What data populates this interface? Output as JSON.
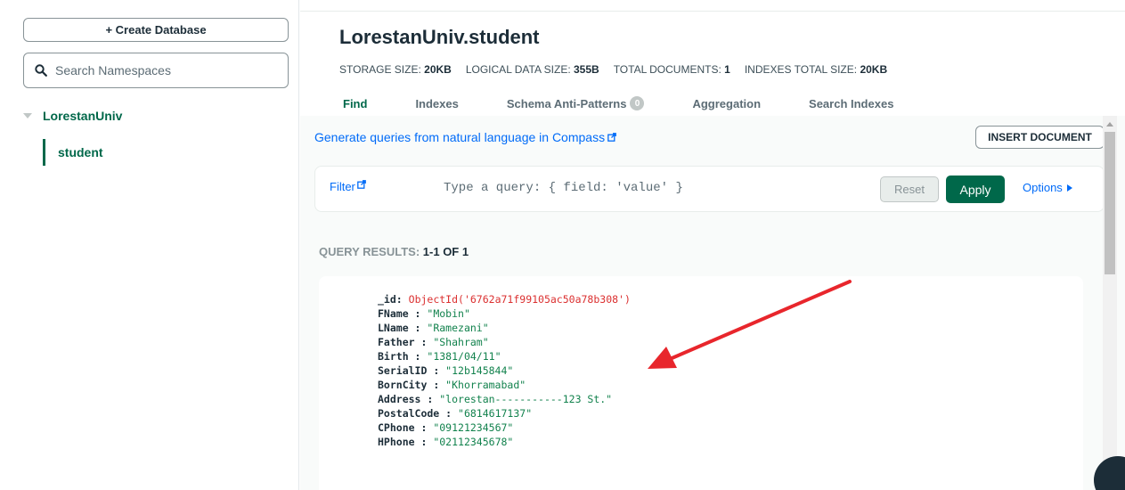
{
  "sidebar": {
    "create_db_label": "+ Create Database",
    "search_placeholder": "Search Namespaces",
    "database": "LorestanUniv",
    "collection": "student"
  },
  "header": {
    "title": "LorestanUniv.student",
    "stats": [
      {
        "label": "STORAGE SIZE:",
        "value": "20KB"
      },
      {
        "label": "LOGICAL DATA SIZE:",
        "value": "355B"
      },
      {
        "label": "TOTAL DOCUMENTS:",
        "value": "1"
      },
      {
        "label": "INDEXES TOTAL SIZE:",
        "value": "20KB"
      }
    ],
    "tabs": [
      {
        "label": "Find",
        "active": true
      },
      {
        "label": "Indexes"
      },
      {
        "label": "Schema Anti-Patterns",
        "badge": "0"
      },
      {
        "label": "Aggregation"
      },
      {
        "label": "Search Indexes"
      }
    ]
  },
  "query": {
    "nl_link": "Generate queries from natural language in Compass",
    "insert_label": "INSERT DOCUMENT",
    "filter_label": "Filter",
    "filter_placeholder": "Type a query: { field: 'value' }",
    "reset_label": "Reset",
    "apply_label": "Apply",
    "options_label": "Options"
  },
  "results": {
    "label": "QUERY RESULTS:",
    "range": "1-1 OF 1",
    "document": [
      {
        "key": "_id",
        "sep": ": ",
        "value": "ObjectId('6762a71f99105ac50a78b308')",
        "type": "oid"
      },
      {
        "key": "FName",
        "sep": " : ",
        "value": "\"Mobin\"",
        "type": "str"
      },
      {
        "key": "LName",
        "sep": " : ",
        "value": "\"Ramezani\"",
        "type": "str"
      },
      {
        "key": "Father",
        "sep": " : ",
        "value": "\"Shahram\"",
        "type": "str"
      },
      {
        "key": "Birth",
        "sep": " : ",
        "value": "\"1381/04/11\"",
        "type": "str"
      },
      {
        "key": "SerialID",
        "sep": " : ",
        "value": "\"12b145844\"",
        "type": "str"
      },
      {
        "key": "BornCity",
        "sep": " : ",
        "value": "\"Khorramabad\"",
        "type": "str"
      },
      {
        "key": "Address",
        "sep": " : ",
        "value": "\"lorestan-----------123 St.\"",
        "type": "str"
      },
      {
        "key": "PostalCode",
        "sep": " : ",
        "value": "\"6814617137\"",
        "type": "str"
      },
      {
        "key": "CPhone",
        "sep": " : ",
        "value": "\"09121234567\"",
        "type": "str"
      },
      {
        "key": "HPhone",
        "sep": " : ",
        "value": "\"02112345678\"",
        "type": "str"
      }
    ]
  },
  "colors": {
    "accent_green": "#00684a",
    "link_blue": "#016bf8",
    "arrow_red": "#e8262c"
  }
}
